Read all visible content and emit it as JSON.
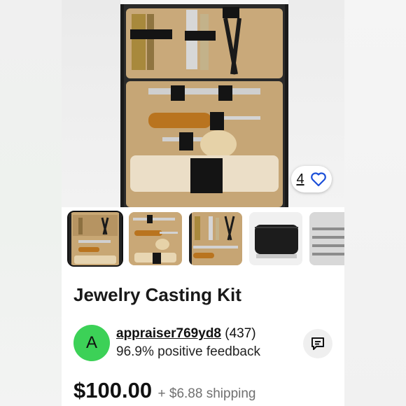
{
  "listing": {
    "title": "Jewelry Casting Kit",
    "favorites_count": "4",
    "price": "$100.00",
    "shipping": "+ $6.88 shipping"
  },
  "gallery": {
    "thumbnail_count_visible": 5,
    "selected_index": 0
  },
  "seller": {
    "avatar_initial": "A",
    "username": "appraiser769yd8",
    "rating_count": "(437)",
    "feedback": "96.9% positive feedback"
  },
  "colors": {
    "avatar_bg": "#3cd157",
    "heart_outline": "#1b4fd8",
    "text_primary": "#191919",
    "text_secondary": "#707070"
  },
  "icons": {
    "favorite": "heart-outline-icon",
    "message": "message-icon"
  }
}
